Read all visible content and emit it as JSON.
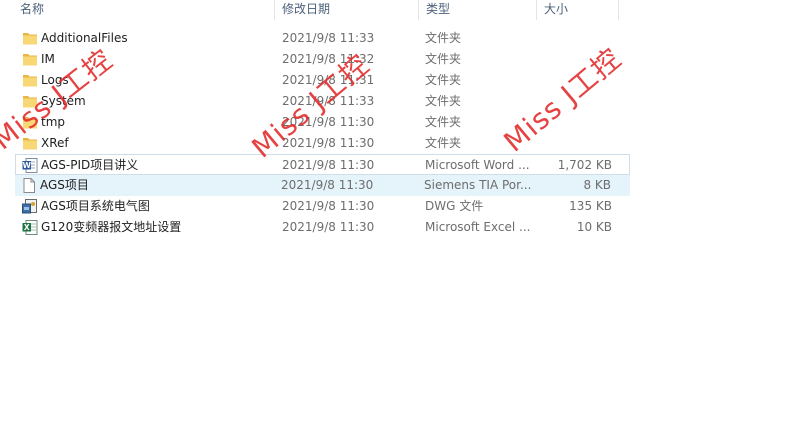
{
  "columns": {
    "name": "名称",
    "date": "修改日期",
    "type": "类型",
    "size": "大小"
  },
  "files": [
    {
      "name": "AdditionalFiles",
      "date": "2021/9/8 11:33",
      "type": "文件夹",
      "size": "",
      "icon": "folder-icon"
    },
    {
      "name": "IM",
      "date": "2021/9/8 11:32",
      "type": "文件夹",
      "size": "",
      "icon": "folder-icon"
    },
    {
      "name": "Logs",
      "date": "2021/9/8 11:31",
      "type": "文件夹",
      "size": "",
      "icon": "folder-icon"
    },
    {
      "name": "System",
      "date": "2021/9/8 11:33",
      "type": "文件夹",
      "size": "",
      "icon": "folder-icon"
    },
    {
      "name": "tmp",
      "date": "2021/9/8 11:30",
      "type": "文件夹",
      "size": "",
      "icon": "folder-icon"
    },
    {
      "name": "XRef",
      "date": "2021/9/8 11:30",
      "type": "文件夹",
      "size": "",
      "icon": "folder-icon"
    },
    {
      "name": "AGS-PID项目讲义",
      "date": "2021/9/8 11:30",
      "type": "Microsoft Word ...",
      "size": "1,702 KB",
      "icon": "word-document-icon"
    },
    {
      "name": "AGS项目",
      "date": "2021/9/8 11:30",
      "type": "Siemens TIA Por...",
      "size": "8 KB",
      "icon": "tia-project-file-icon"
    },
    {
      "name": "AGS项目系统电气图",
      "date": "2021/9/8 11:30",
      "type": "DWG 文件",
      "size": "135 KB",
      "icon": "dwg-file-icon"
    },
    {
      "name": "G120变频器报文地址设置",
      "date": "2021/9/8 11:30",
      "type": "Microsoft Excel ...",
      "size": "10 KB",
      "icon": "excel-workbook-icon"
    }
  ],
  "watermarks": [
    "Miss J工控",
    "Miss J工控",
    "Miss J工控"
  ],
  "colors": {
    "folder": "#f8d775",
    "watermark": "#e22828",
    "selection": "#e5f3fb"
  }
}
